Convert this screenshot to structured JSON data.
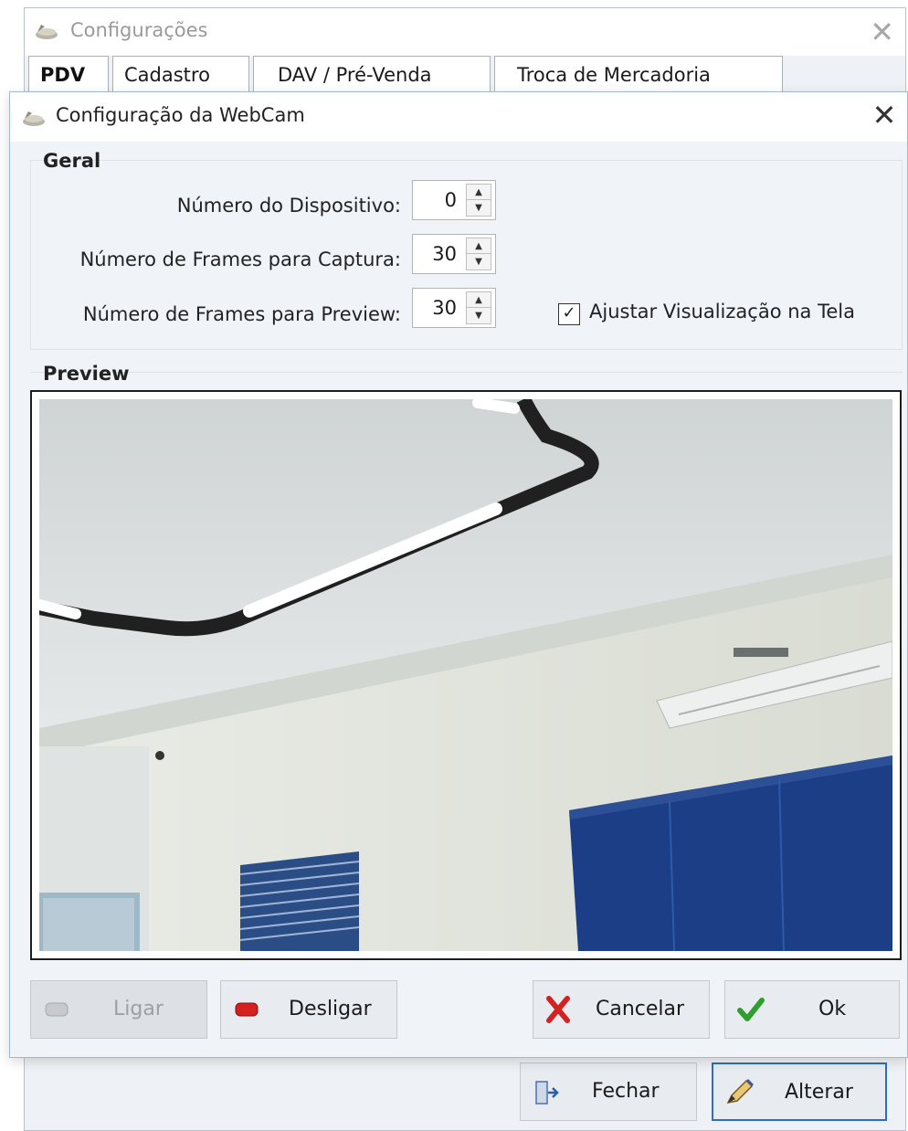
{
  "background_window": {
    "title": "Configurações",
    "close_glyph": "✕",
    "tabs": [
      {
        "label": "PDV",
        "active": true
      },
      {
        "label": "Cadastro",
        "active": false
      },
      {
        "label": "DAV / Pré-Venda",
        "active": false
      },
      {
        "label": "Troca de Mercadoria",
        "active": false
      }
    ],
    "buttons": {
      "fechar_label": "Fechar",
      "fechar_icon": "door-exit-icon",
      "alterar_label": "Alterar",
      "alterar_icon": "pencil-edit-icon"
    }
  },
  "dialog": {
    "title": "Configuração da WebCam",
    "close_glyph": "✕",
    "geral": {
      "heading": "Geral",
      "fields": [
        {
          "label": "Número do Dispositivo:",
          "value": "0"
        },
        {
          "label": "Número de Frames para Captura:",
          "value": "30"
        },
        {
          "label": "Número de Frames para Preview:",
          "value": "30"
        }
      ],
      "ajustar_checkbox": {
        "label": "Ajustar Visualização na Tela",
        "checked": true,
        "glyph": "✓"
      }
    },
    "preview": {
      "heading": "Preview",
      "image_icon": "webcam-preview-image"
    },
    "buttons": {
      "ligar_label": "Ligar",
      "desligar_label": "Desligar",
      "cancelar_label": "Cancelar",
      "ok_label": "Ok"
    },
    "colors": {
      "desligar_red": "#d42020",
      "cancelar_red": "#d22222",
      "ok_green": "#2e9e2e",
      "accent_blue": "#2b6fc2"
    }
  }
}
